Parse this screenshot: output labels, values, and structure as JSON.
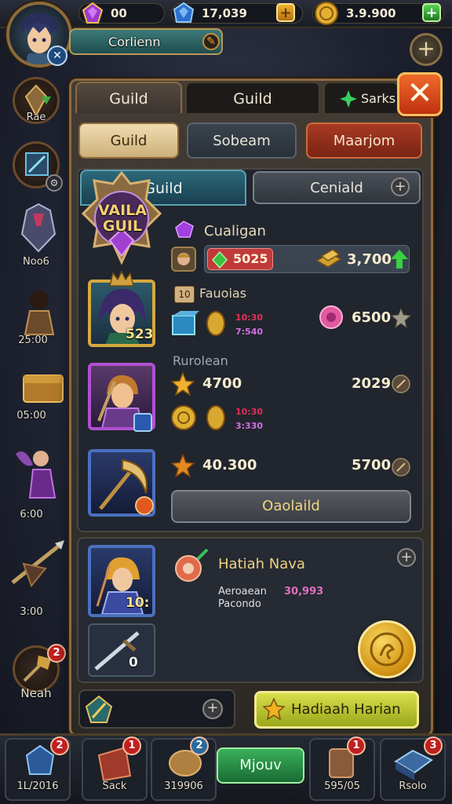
{
  "colors": {
    "gold": "#d6a840",
    "panel": "#433c35",
    "accent_green": "#3ab05a",
    "close_red": "#c03010"
  },
  "topbar": {
    "gem_value": "00",
    "sapphire_value": "17,039",
    "gold_value": "3.9.900"
  },
  "player": {
    "name": "Corlienn"
  },
  "sidebar": {
    "items": [
      {
        "label": "Rae",
        "icon": "sword-icon"
      },
      {
        "label": "Noo6",
        "icon": "flag-icon"
      },
      {
        "label": "25:00",
        "icon": "scroll-icon"
      },
      {
        "label": "05:00",
        "icon": "chest-icon"
      },
      {
        "label": "6:00",
        "icon": "fairy-icon"
      },
      {
        "label": "3:00",
        "icon": "spear-icon"
      },
      {
        "label": "Neah",
        "icon": "hammer-icon"
      }
    ]
  },
  "panel": {
    "tabs": [
      "Guild",
      "Guild",
      "Sarks"
    ],
    "subtabs": [
      "Guild",
      "Sobeam",
      "Maarjom"
    ],
    "inner_tabs": [
      "Guild",
      "Ceniald"
    ],
    "guild_emblem_text": "VAILA GUIL",
    "guild_name": "Cualigan",
    "row1": {
      "gem_amount": "5025",
      "gold_amount": "3,700"
    },
    "hero1": {
      "level": "523",
      "title": "Fauoias",
      "stat_a": "10:30",
      "stat_b": "7:540",
      "rose_amount": "6500"
    },
    "section_title": "Rurolean",
    "hero2": {
      "star_amount": "4700",
      "right_amount": "2029",
      "stat_a": "10:30",
      "stat_b": "3:330"
    },
    "hero3": {
      "star_amount": "40.300",
      "right_amount": "5700"
    },
    "wide_button": "Oaolaild"
  },
  "lower": {
    "item_title": "Hatiah Nava",
    "item_line1": "Aeroaean",
    "item_line1_value": "30,993",
    "item_line2": "Pacondo",
    "hero_level": "10:",
    "sword_level": "0",
    "claim_button": "Hadiaah Harian"
  },
  "bottom_nav": {
    "items": [
      {
        "label": "1L/2016",
        "badge": "2"
      },
      {
        "label": "Sack",
        "badge": "1"
      },
      {
        "label": "319906",
        "badge": "2"
      },
      {
        "label": "Mjouv",
        "badge": ""
      },
      {
        "label": "595/05",
        "badge": "1"
      },
      {
        "label": "Rsolo",
        "badge": "3"
      }
    ]
  }
}
